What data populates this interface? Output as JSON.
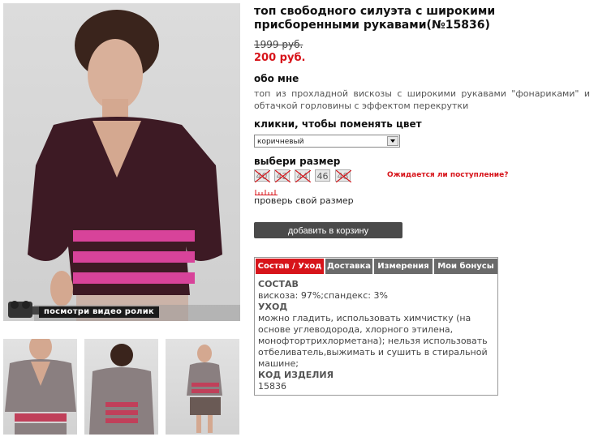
{
  "product": {
    "title": "топ свободного силуэта с широкими присборенными рукавами(№15836)",
    "old_price": "1999 руб.",
    "new_price": "200 руб."
  },
  "about": {
    "heading": "обо мне",
    "text": "топ из прохладной вискозы с широкими рукавами \"фонариками\" и обтачкой горловины с эффектом перекрутки"
  },
  "color": {
    "heading": "кликни, чтобы поменять цвет",
    "selected": "коричневый"
  },
  "size": {
    "heading": "выбери размер",
    "options": [
      {
        "label": "40",
        "available": false
      },
      {
        "label": "42",
        "available": false
      },
      {
        "label": "44",
        "available": false
      },
      {
        "label": "46",
        "available": true
      },
      {
        "label": "48",
        "available": false
      }
    ],
    "notify_link": "Ожидается ли поступление?",
    "check_size": "проверь свой размер"
  },
  "cart": {
    "label": "добавить в корзину"
  },
  "video": {
    "label": "посмотри видео ролик"
  },
  "tabs": [
    {
      "label": "Состав / Уход",
      "active": true
    },
    {
      "label": "Доставка",
      "active": false
    },
    {
      "label": "Измерения",
      "active": false
    },
    {
      "label": "Мои бонусы",
      "active": false
    }
  ],
  "details": {
    "composition_h": "СОСТАВ",
    "composition": "вискоза: 97%;спандекс: 3%",
    "care_h": "УХОД",
    "care": "можно гладить, использовать химчистку (на основе углеводорода, хлорного этилена, монофтортрихлорметана); нельзя использовать отбеливатель,выжимать и сушить в стиральной машине;",
    "code_h": "КОД ИЗДЕЛИЯ",
    "code": "15836"
  },
  "colors": {
    "accent": "#d7141a",
    "top_brown": "#3d1a24",
    "stripe_pink": "#d8439a"
  }
}
